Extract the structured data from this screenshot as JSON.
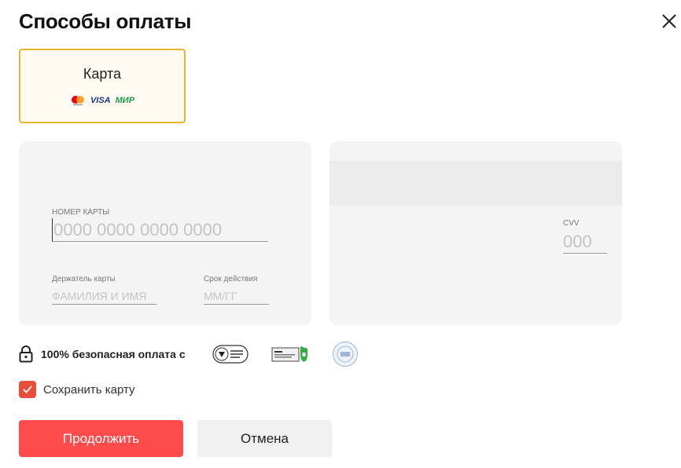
{
  "dialog": {
    "title": "Способы оплаты"
  },
  "payment_method": {
    "label": "Карта",
    "logos": [
      "mastercard-logo",
      "visa-logo",
      "mir-logo"
    ],
    "visa_text": "VISA",
    "mir_text": "МИР",
    "border_color": "#e8b52b"
  },
  "card_front": {
    "number_label": "НОМЕР КАРТЫ",
    "number_placeholder": "0000 0000 0000 0000",
    "number_value": "",
    "holder_label": "Держатель карты",
    "holder_placeholder": "ФАМИЛИЯ И ИМЯ",
    "holder_value": "",
    "expiry_label": "Срок действия",
    "expiry_placeholder": "ММ/ГГ",
    "expiry_value": ""
  },
  "card_back": {
    "cvv_label": "CVV",
    "cvv_placeholder": "000",
    "cvv_value": ""
  },
  "security": {
    "text": "100% безопасная оплата с",
    "icons": [
      "lock-icon",
      "iso-badge",
      "ssl-badge",
      "pci-badge"
    ]
  },
  "save_card": {
    "label": "Сохранить карту",
    "checked": true,
    "checkbox_color": "#e84c3d"
  },
  "buttons": {
    "continue_label": "Продолжить",
    "cancel_label": "Отмена",
    "primary_color": "#ff4b4b"
  }
}
